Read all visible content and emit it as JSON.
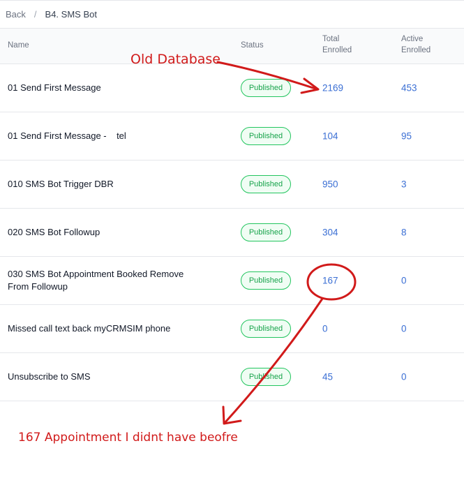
{
  "breadcrumb": {
    "back": "Back",
    "separator": "/",
    "current": "B4. SMS Bot"
  },
  "table": {
    "columns": {
      "name": "Name",
      "status": "Status",
      "total": "Total\nEnrolled",
      "active": "Active\nEnrolled"
    },
    "rows": [
      {
        "name": "01 Send First Message",
        "status": "Published",
        "total": "2169",
        "active": "453"
      },
      {
        "name": "01 Send First Message -    tel",
        "status": "Published",
        "total": "104",
        "active": "95"
      },
      {
        "name": "010 SMS Bot Trigger DBR",
        "status": "Published",
        "total": "950",
        "active": "3"
      },
      {
        "name": "020 SMS Bot Followup",
        "status": "Published",
        "total": "304",
        "active": "8"
      },
      {
        "name": "030 SMS Bot Appointment Booked Remove From Followup",
        "status": "Published",
        "total": "167",
        "active": "0"
      },
      {
        "name": "Missed call text back myCRMSIM phone",
        "status": "Published",
        "total": "0",
        "active": "0"
      },
      {
        "name": "Unsubscribe to SMS",
        "status": "Published",
        "total": "45",
        "active": "0"
      }
    ]
  },
  "annotations": {
    "old_database": "Old Database",
    "bottom_note": "167 Appointment I didnt have beofre",
    "color": "#d11a1a"
  },
  "colors": {
    "link_number": "#3b6fd4",
    "badge_green": "#16a34a",
    "badge_border": "#22c55e"
  }
}
